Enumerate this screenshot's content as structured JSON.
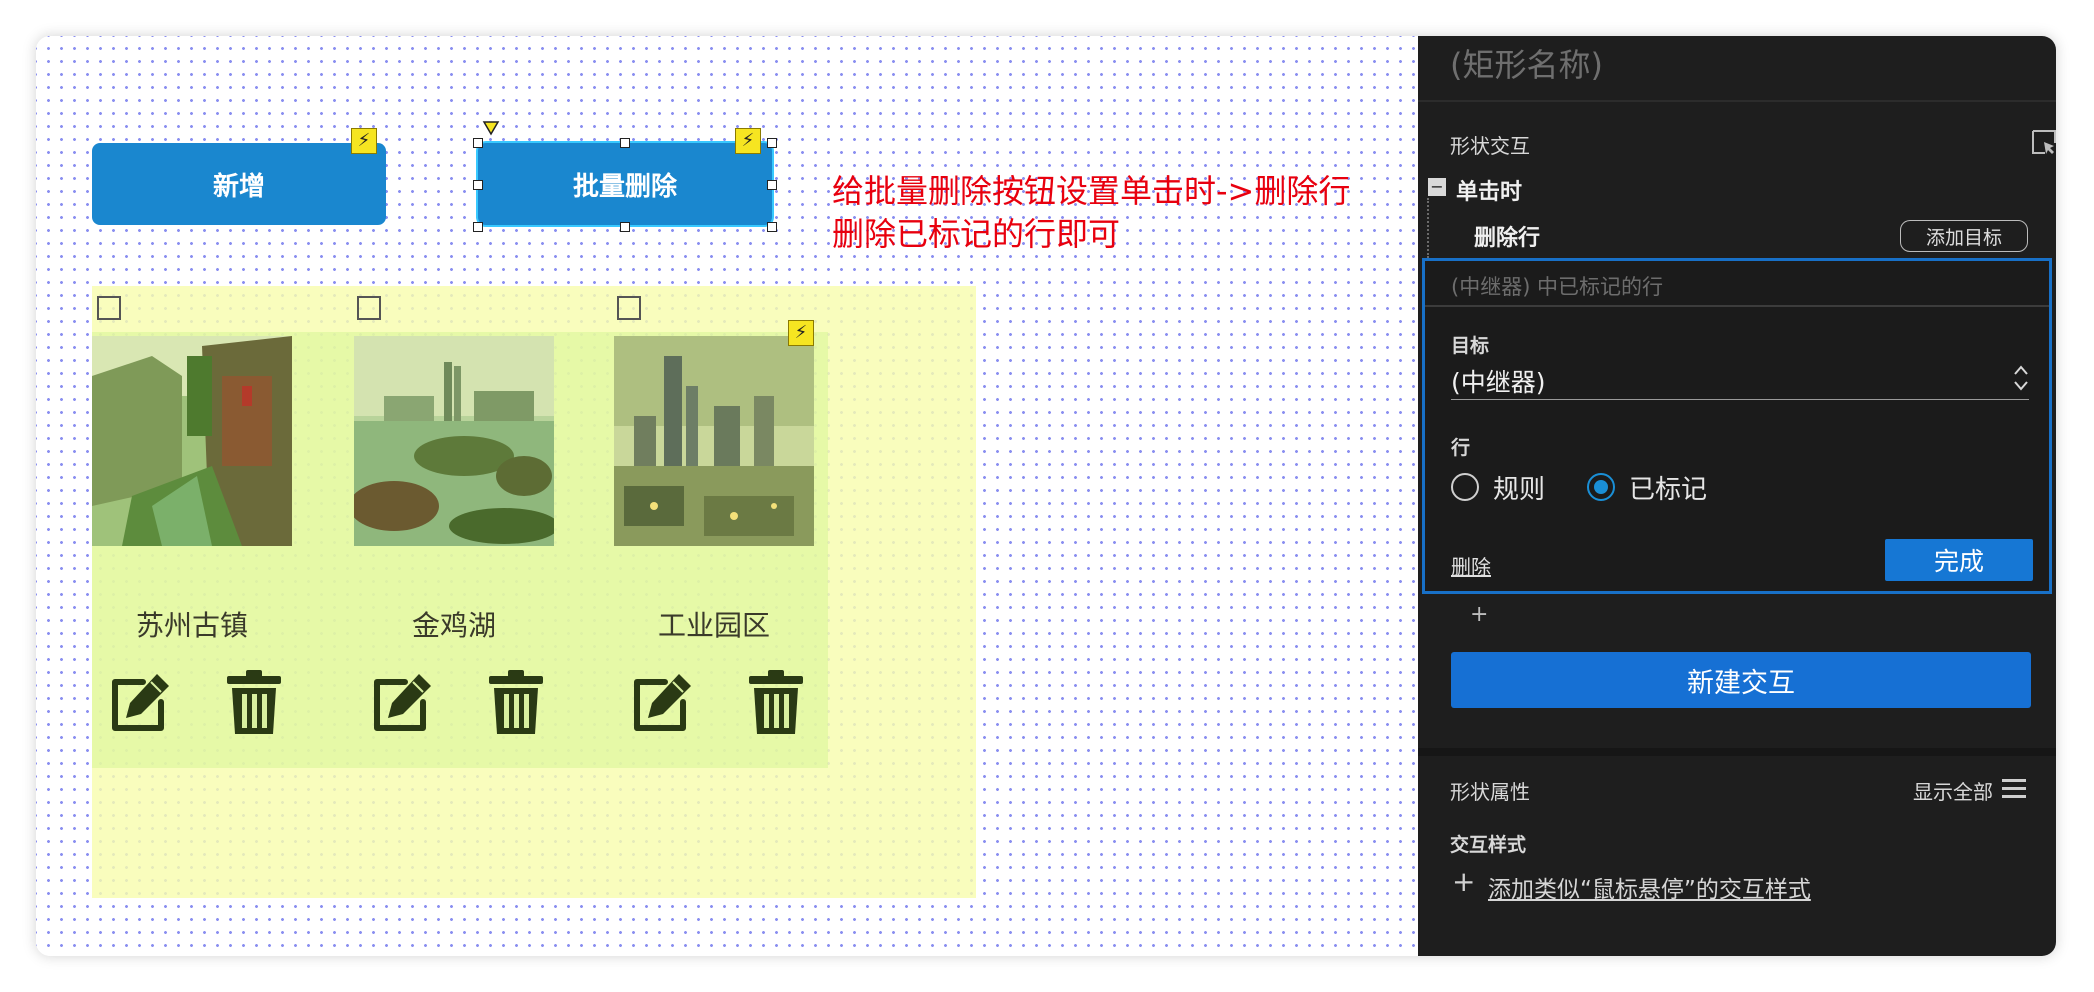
{
  "canvas": {
    "add_button_label": "新增",
    "batch_delete_button_label": "批量删除",
    "items": [
      {
        "caption": "苏州古镇"
      },
      {
        "caption": "金鸡湖"
      },
      {
        "caption": "工业园区"
      }
    ],
    "annotation_line1": "给批量删除按钮设置单击时->删除行",
    "annotation_line2": "删除已标记的行即可"
  },
  "panel": {
    "shape_name_placeholder": "(矩形名称)",
    "shape_interaction_title": "形状交互",
    "collapse_symbol": "−",
    "event_label": "单击时",
    "action_label": "删除行",
    "add_target_label": "添加目标",
    "editor": {
      "summary": "(中继器) 中已标记的行",
      "target_label": "目标",
      "target_value": "(中继器)",
      "rows_label": "行",
      "option_rule": "规则",
      "option_marked": "已标记",
      "selected": "已标记",
      "delete_link": "删除",
      "done_label": "完成"
    },
    "plus_symbol": "+",
    "new_interaction_label": "新建交互",
    "shape_properties_title": "形状属性",
    "show_all_label": "显示全部",
    "interaction_style_title": "交互样式",
    "add_style_plus": "+",
    "add_style_link": "添加类似“鼠标悬停”的交互样式"
  },
  "colors": {
    "button_blue": "#1a87cf",
    "annotation_red": "#e8000e",
    "panel_bg": "#1e1e1e",
    "accent_blue": "#1677d4",
    "lightning_yellow": "#f6e521"
  },
  "icons": [
    "lightning-icon",
    "edit-icon",
    "trash-icon",
    "checkbox-icon",
    "select-arrow-icon",
    "hamburger-icon",
    "pointer-target-icon"
  ]
}
